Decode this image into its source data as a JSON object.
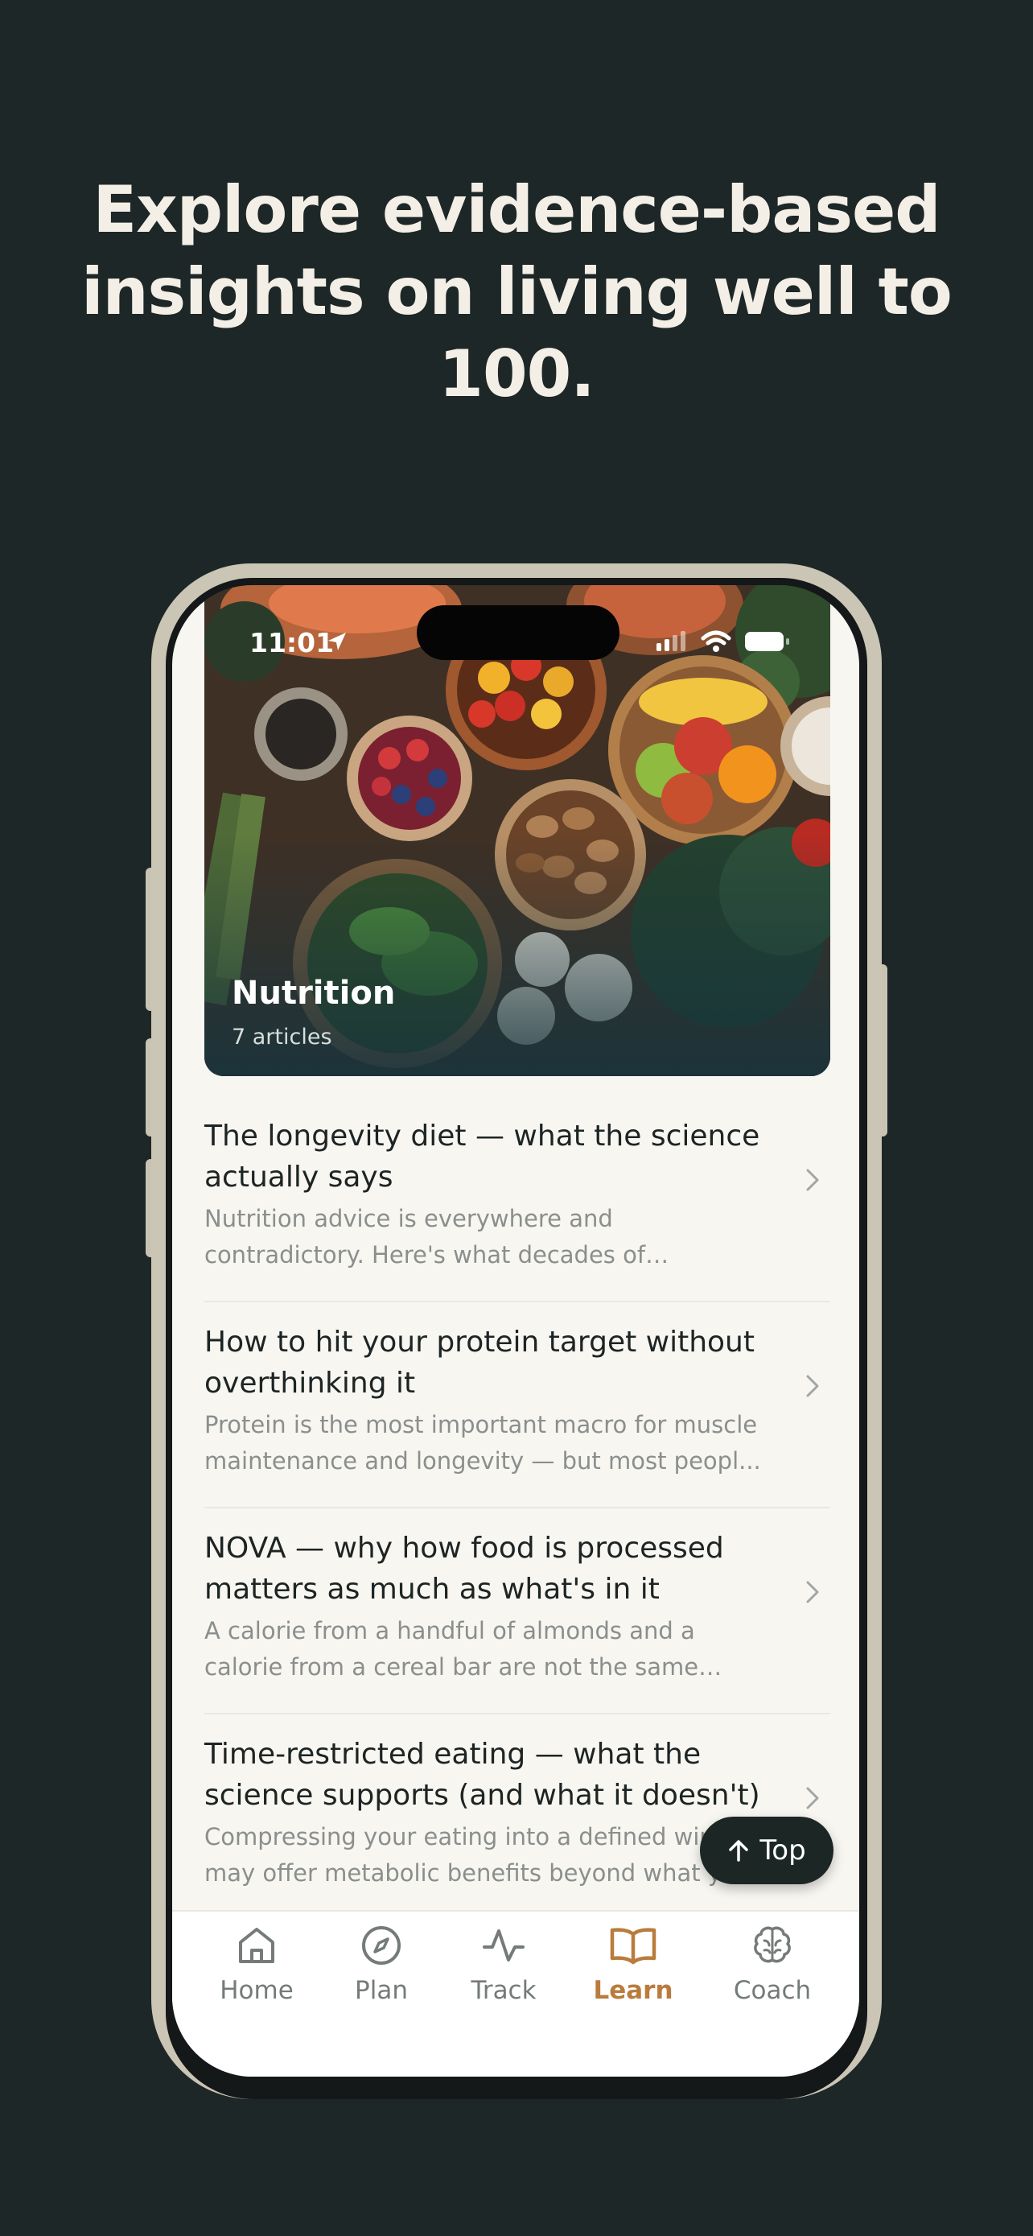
{
  "headline": "Explore evidence-based insights on living well to 100.",
  "status_bar": {
    "time": "11:01"
  },
  "hero": {
    "title": "Nutrition",
    "subtitle": "7 articles"
  },
  "articles": [
    {
      "title": "The longevity diet — what the science actually says",
      "desc": "Nutrition advice is everywhere and contradictory. Here's what decades of research..."
    },
    {
      "title": "How to hit your protein target without overthinking it",
      "desc": "Protein is the most important macro for muscle maintenance and longevity — but most peopl..."
    },
    {
      "title": "NOVA — why how food is processed matters as much as what's in it",
      "desc": "A calorie from a handful of almonds and a calorie from a cereal bar are not the same thin..."
    },
    {
      "title": "Time-restricted eating — what the science supports (and what it doesn't)",
      "desc": "Compressing your eating into a defined window may offer metabolic benefits beyond what y..."
    }
  ],
  "top_button": {
    "label": "Top"
  },
  "tabs": [
    {
      "label": "Home",
      "icon": "home-icon"
    },
    {
      "label": "Plan",
      "icon": "compass-icon"
    },
    {
      "label": "Track",
      "icon": "activity-icon"
    },
    {
      "label": "Learn",
      "icon": "book-icon",
      "active": true
    },
    {
      "label": "Coach",
      "icon": "brain-icon"
    }
  ],
  "colors": {
    "background": "#1d2727",
    "accent": "#b97c3d",
    "screen": "#f8f6f1"
  }
}
